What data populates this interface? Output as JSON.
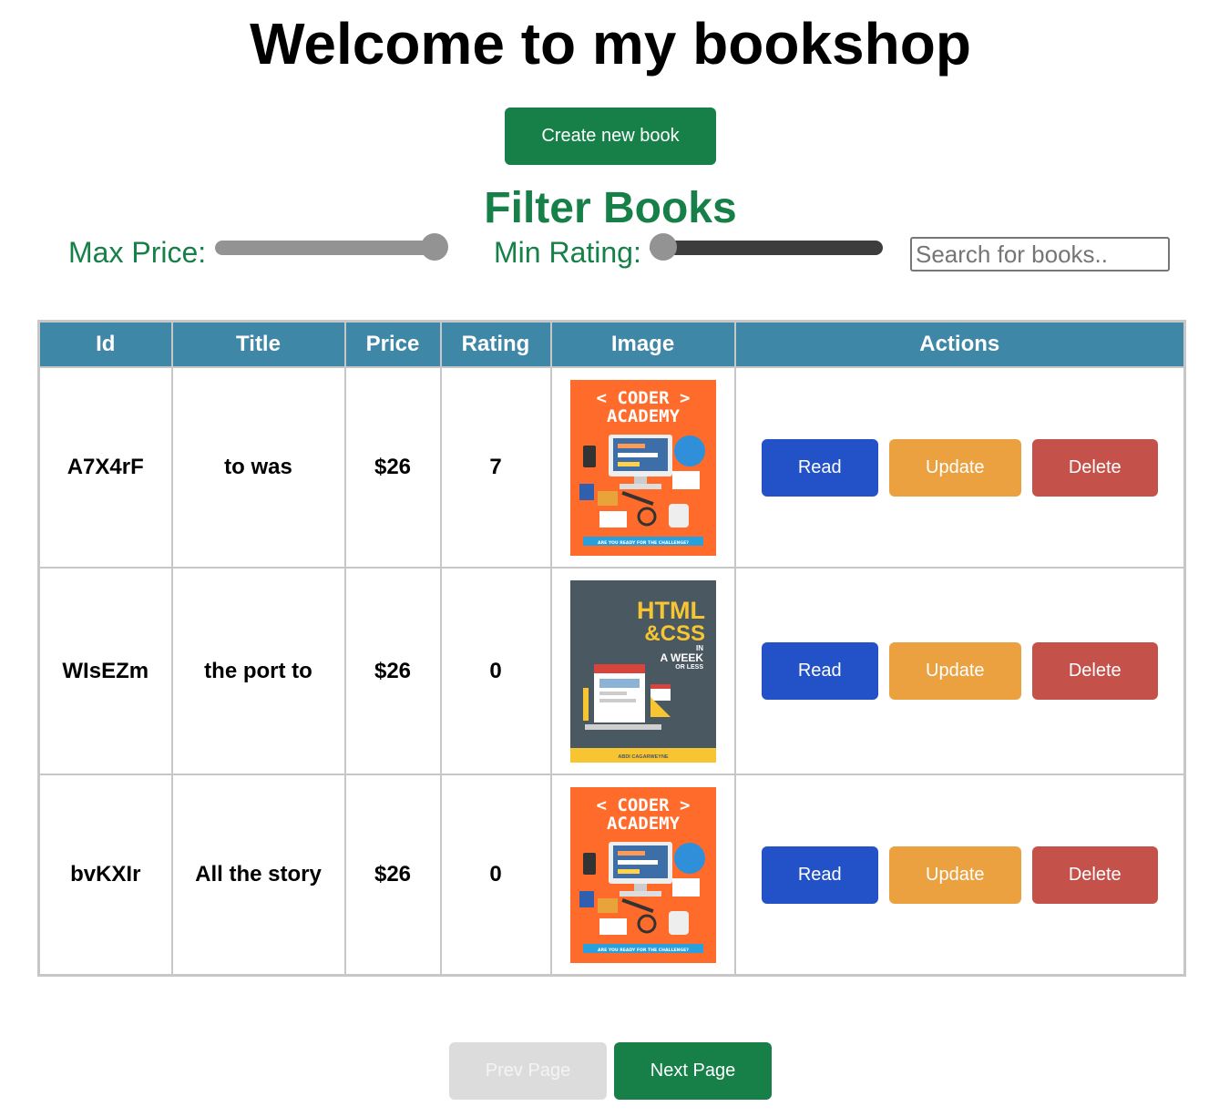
{
  "page": {
    "title": "Welcome to my bookshop",
    "create_button": "Create new book"
  },
  "filters": {
    "title": "Filter Books",
    "max_price_label": "Max Price:",
    "max_price_level": 1.0,
    "min_rating_label": "Min Rating:",
    "min_rating_level": 0.0,
    "search_placeholder": "Search for books.."
  },
  "table": {
    "headers": {
      "id": "Id",
      "title": "Title",
      "price": "Price",
      "rating": "Rating",
      "image": "Image",
      "actions": "Actions"
    },
    "rows": [
      {
        "id": "A7X4rF",
        "title": "to was",
        "price": "$26",
        "rating": "7",
        "cover": "coder-academy",
        "cover_text": [
          "< CODER >",
          "ACADEMY",
          "ARE YOU READY FOR THE CHALLENGE?"
        ]
      },
      {
        "id": "WIsEZm",
        "title": "the port to",
        "price": "$26",
        "rating": "0",
        "cover": "html-css",
        "cover_text": [
          "HTML",
          "&CSS",
          "IN",
          "A WEEK",
          "OR LESS",
          "ABDI CAGARWEYNE"
        ]
      },
      {
        "id": "bvKXIr",
        "title": "All the story",
        "price": "$26",
        "rating": "0",
        "cover": "coder-academy",
        "cover_text": [
          "< CODER >",
          "ACADEMY",
          "ARE YOU READY FOR THE CHALLENGE?"
        ]
      }
    ],
    "actions": {
      "read": "Read",
      "update": "Update",
      "delete": "Delete"
    }
  },
  "pagination": {
    "prev": "Prev Page",
    "next": "Next Page",
    "prev_disabled": true
  },
  "colors": {
    "brand_green": "#168048",
    "header_blue": "#3f87a6",
    "read_blue": "#2351c8",
    "update_orange": "#eba13f",
    "delete_red": "#c4524a",
    "coder_cover_orange": "#ff6b2b",
    "html_cover_slate": "#4a5862"
  }
}
